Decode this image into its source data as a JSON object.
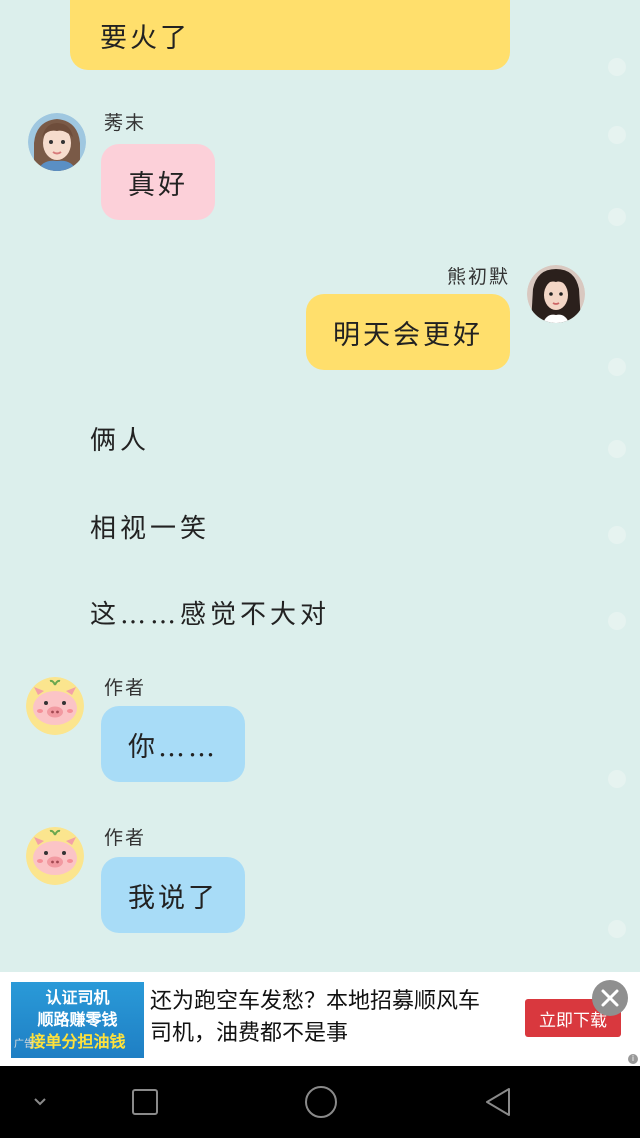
{
  "chat": {
    "top_bubble": "要火了",
    "messages": [
      {
        "sender": "莠末",
        "text": "真好"
      },
      {
        "sender": "熊初默",
        "text": "明天会更好"
      }
    ],
    "narration": [
      "俩人",
      "相视一笑",
      "这……感觉不大对"
    ],
    "author_messages": [
      {
        "sender": "作者",
        "text": "你……"
      },
      {
        "sender": "作者",
        "text": "我说了"
      }
    ]
  },
  "ad": {
    "image_lines": [
      "认证司机",
      "顺路赚零钱",
      "接单分担油钱"
    ],
    "image_tag": "广告",
    "text": "还为跑空车发愁？本地招募顺风车司机，油费都不是事",
    "button_label": "立即下载",
    "info_label": "i"
  },
  "colors": {
    "background": "#dcefec",
    "yellow_bubble": "#ffdf6c",
    "pink_bubble": "#fcd0d9",
    "blue_bubble": "#a8dcf7",
    "ad_button": "#d9383e"
  },
  "icons": [
    "close-icon",
    "nav-back-icon",
    "nav-home-icon",
    "nav-recents-icon",
    "nav-down-icon"
  ]
}
